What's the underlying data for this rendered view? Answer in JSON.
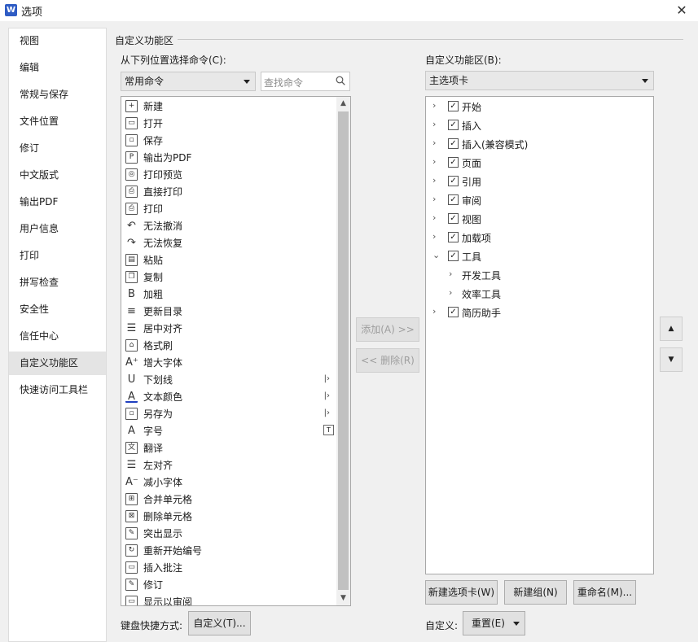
{
  "window": {
    "title": "选项",
    "logo": "W",
    "close": "✕"
  },
  "sidebar": {
    "items": [
      {
        "label": "视图"
      },
      {
        "label": "编辑"
      },
      {
        "label": "常规与保存"
      },
      {
        "label": "文件位置"
      },
      {
        "label": "修订"
      },
      {
        "label": "中文版式"
      },
      {
        "label": "输出PDF"
      },
      {
        "label": "用户信息"
      },
      {
        "label": "打印"
      },
      {
        "label": "拼写检查"
      },
      {
        "label": "安全性"
      },
      {
        "label": "信任中心"
      },
      {
        "label": "自定义功能区",
        "active": true
      },
      {
        "label": "快速访问工具栏"
      }
    ]
  },
  "section": {
    "title": "自定义功能区"
  },
  "left": {
    "label": "从下列位置选择命令(C):",
    "select_value": "常用命令",
    "search_placeholder": "查找命令",
    "commands": [
      {
        "label": "新建",
        "icon": "new-doc-icon",
        "glyph": "+"
      },
      {
        "label": "打开",
        "icon": "folder-open-icon",
        "glyph": "▭"
      },
      {
        "label": "保存",
        "icon": "save-icon",
        "glyph": "▫"
      },
      {
        "label": "输出为PDF",
        "icon": "export-pdf-icon",
        "glyph": "P"
      },
      {
        "label": "打印预览",
        "icon": "print-preview-icon",
        "glyph": "◎"
      },
      {
        "label": "直接打印",
        "icon": "direct-print-icon",
        "glyph": "⎙"
      },
      {
        "label": "打印",
        "icon": "print-icon",
        "glyph": "⎙"
      },
      {
        "label": "无法撤消",
        "icon": "undo-icon",
        "glyph": "↶"
      },
      {
        "label": "无法恢复",
        "icon": "redo-icon",
        "glyph": "↷"
      },
      {
        "label": "粘贴",
        "icon": "paste-icon",
        "glyph": "▤"
      },
      {
        "label": "复制",
        "icon": "copy-icon",
        "glyph": "❐"
      },
      {
        "label": "加粗",
        "icon": "bold-icon",
        "glyph": "B"
      },
      {
        "label": "更新目录",
        "icon": "update-toc-icon",
        "glyph": "≡"
      },
      {
        "label": "居中对齐",
        "icon": "align-center-icon",
        "glyph": "☰"
      },
      {
        "label": "格式刷",
        "icon": "format-painter-icon",
        "glyph": "⌂"
      },
      {
        "label": "增大字体",
        "icon": "font-grow-icon",
        "glyph": "A⁺"
      },
      {
        "label": "下划线",
        "icon": "underline-icon",
        "glyph": "U",
        "submenu": true
      },
      {
        "label": "文本颜色",
        "icon": "text-color-icon",
        "glyph": "A",
        "submenu": true
      },
      {
        "label": "另存为",
        "icon": "save-as-icon",
        "glyph": "▫",
        "submenu": true
      },
      {
        "label": "字号",
        "icon": "font-size-icon",
        "glyph": "A",
        "dropdown": true
      },
      {
        "label": "翻译",
        "icon": "translate-icon",
        "glyph": "文"
      },
      {
        "label": "左对齐",
        "icon": "align-left-icon",
        "glyph": "☰"
      },
      {
        "label": "减小字体",
        "icon": "font-shrink-icon",
        "glyph": "A⁻"
      },
      {
        "label": "合并单元格",
        "icon": "merge-cells-icon",
        "glyph": "⊞"
      },
      {
        "label": "删除单元格",
        "icon": "delete-cells-icon",
        "glyph": "⊠"
      },
      {
        "label": "突出显示",
        "icon": "highlight-icon",
        "glyph": "✎"
      },
      {
        "label": "重新开始编号",
        "icon": "restart-numbering-icon",
        "glyph": "↻"
      },
      {
        "label": "插入批注",
        "icon": "insert-comment-icon",
        "glyph": "▭"
      },
      {
        "label": "修订",
        "icon": "track-changes-icon",
        "glyph": "✎"
      },
      {
        "label": "显示以审阅",
        "icon": "show-review-icon",
        "glyph": "▭"
      }
    ]
  },
  "middle": {
    "add": "添加(A) >>",
    "remove": "<< 删除(R)"
  },
  "right": {
    "label": "自定义功能区(B):",
    "select_value": "主选项卡",
    "tree": [
      {
        "label": "开始",
        "level": 0,
        "checked": true,
        "expander": "›"
      },
      {
        "label": "插入",
        "level": 0,
        "checked": true,
        "expander": "›"
      },
      {
        "label": "插入(兼容模式)",
        "level": 0,
        "checked": true,
        "expander": "›"
      },
      {
        "label": "页面",
        "level": 0,
        "checked": true,
        "expander": "›"
      },
      {
        "label": "引用",
        "level": 0,
        "checked": true,
        "expander": "›"
      },
      {
        "label": "审阅",
        "level": 0,
        "checked": true,
        "expander": "›"
      },
      {
        "label": "视图",
        "level": 0,
        "checked": true,
        "expander": "›"
      },
      {
        "label": "加载项",
        "level": 0,
        "checked": true,
        "expander": "›"
      },
      {
        "label": "工具",
        "level": 0,
        "checked": true,
        "expander": "⌄",
        "selected": true
      },
      {
        "label": "开发工具",
        "level": 1,
        "checked": null,
        "expander": "›"
      },
      {
        "label": "效率工具",
        "level": 1,
        "checked": null,
        "expander": "›"
      },
      {
        "label": "简历助手",
        "level": 0,
        "checked": true,
        "expander": "›"
      }
    ],
    "move_up": "▲",
    "move_down": "▼",
    "new_tab": "新建选项卡(W)",
    "new_group": "新建组(N)",
    "rename": "重命名(M)...",
    "customize_label": "自定义:",
    "reset": "重置(E)"
  },
  "keyboard": {
    "label": "键盘快捷方式:",
    "button": "自定义(T)..."
  }
}
